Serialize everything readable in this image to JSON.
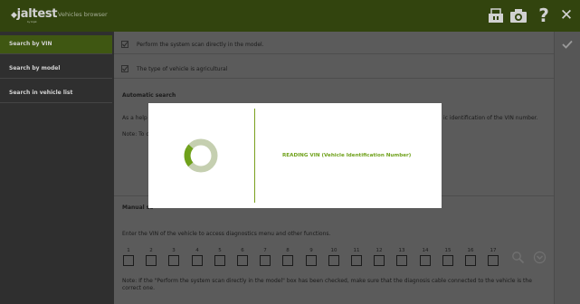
{
  "header": {
    "logo_text": "jaltest",
    "logo_sub": "by Cojali",
    "title": "Vehicles browser",
    "icons": [
      "usb-device-icon",
      "camera-icon",
      "help-icon",
      "close-icon"
    ],
    "help_glyph": "?",
    "close_glyph": "✕"
  },
  "sidebar": {
    "items": [
      {
        "label": "Search by VIN",
        "active": true
      },
      {
        "label": "Search by model",
        "active": false
      },
      {
        "label": "Search in vehicle list",
        "active": false
      }
    ]
  },
  "options": {
    "scan_label": "Perform the system scan directly in the model.",
    "agri_label": "The type of vehicle is agricultural"
  },
  "automatic": {
    "title": "Automatic search",
    "line1_start": "As a help",
    "line1_end": "ic identification of the VIN number.",
    "note": "Note: To c"
  },
  "manual": {
    "title_fragment": "Manual se",
    "description": "Enter the VIN of the vehicle to access diagnostics menu and other functions.",
    "digits": [
      "1",
      "2",
      "3",
      "4",
      "5",
      "6",
      "7",
      "8",
      "9",
      "10",
      "11",
      "12",
      "13",
      "14",
      "15",
      "16",
      "17"
    ],
    "note_line1": "Note: If the \"Perform the system scan directly in the model\" box has been checked, make sure that the diagnosis cable connected to the vehicle is the",
    "note_line2": "correct one."
  },
  "modal": {
    "message": "READING VIN (Vehicle Identification Number)"
  },
  "colors": {
    "accent": "#6fa11a",
    "header": "#3d5412",
    "sidebar_active": "#4d6b16"
  }
}
